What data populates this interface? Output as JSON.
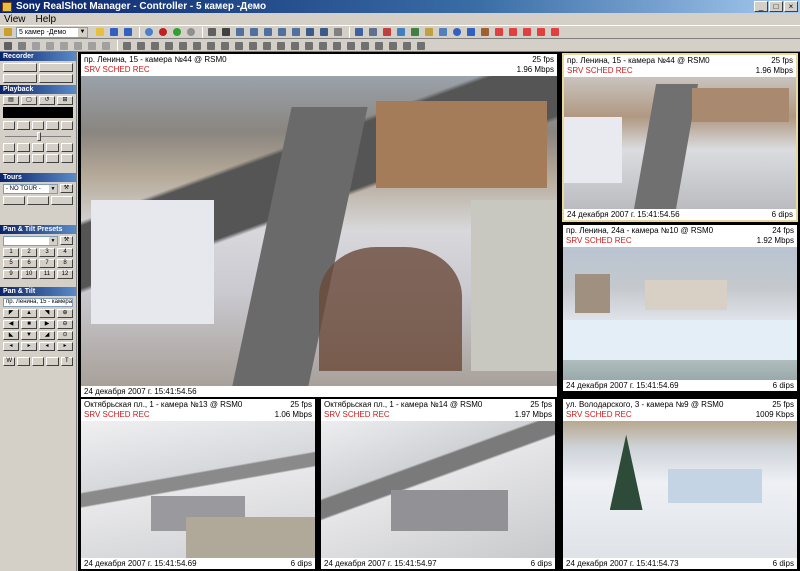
{
  "window": {
    "title": "Sony RealShot Manager - Controller - 5 камер -Демо"
  },
  "menu": [
    "View",
    "Help"
  ],
  "toolbar": {
    "preset_value": "5 камер -Демо"
  },
  "left_panel": {
    "recorder": "Recorder",
    "playback": "Playback",
    "tours": "Tours",
    "tour_value": "- NO TOUR -",
    "presets": "Pan & Tilt Presets",
    "preset_numbers": [
      "1",
      "2",
      "3",
      "4",
      "5",
      "6",
      "7",
      "8",
      "9",
      "10",
      "11",
      "12"
    ],
    "pan_tilt": "Pan & Tilt",
    "current_camera": "пр. Ленина, 15 - камера №4",
    "ptz_row": [
      "W",
      "",
      "",
      "",
      "T"
    ]
  },
  "colors": {
    "rec": "#c81e1e",
    "selected_border": "#e8d89a",
    "title_bar": "#0a246a"
  },
  "tiles": [
    {
      "camera": "пр. Ленина, 15 - камера №44 @ RSM0",
      "fps": "25 fps",
      "rec": "SRV SCHED REC",
      "rate": "1.96 Mbps",
      "timestamp": "24 декабря 2007 г. 15:41:54.56",
      "dips": ""
    },
    {
      "camera": "пр. Ленина, 15 - камера №44 @ RSM0",
      "fps": "25 fps",
      "rec": "SRV SCHED REC",
      "rate": "1.96 Mbps",
      "timestamp": "24 декабря 2007 г. 15:41:54.56",
      "dips": "6 dips"
    },
    {
      "camera": "пр. Ленина, 24а - камера №10 @ RSM0",
      "fps": "24 fps",
      "rec": "SRV SCHED REC",
      "rate": "1.92 Mbps",
      "timestamp": "24 декабря 2007 г. 15:41:54.69",
      "dips": "6 dips"
    },
    {
      "camera": "Октябрьская пл., 1 - камера №13 @ RSM0",
      "fps": "25 fps",
      "rec": "SRV SCHED REC",
      "rate": "1.06 Mbps",
      "timestamp": "24 декабря 2007 г. 15:41:54.69",
      "dips": "6 dips"
    },
    {
      "camera": "Октябрьская пл., 1 - камера №14 @ RSM0",
      "fps": "25 fps",
      "rec": "SRV SCHED REC",
      "rate": "1.97 Mbps",
      "timestamp": "24 декабря 2007 г. 15:41:54.97",
      "dips": "6 dips"
    },
    {
      "camera": "ул. Володарского, 3 - камера №9 @ RSM0",
      "fps": "25 fps",
      "rec": "SRV SCHED REC",
      "rate": "1009 Kbps",
      "timestamp": "24 декабря 2007 г. 15:41:54.73",
      "dips": "6 dips"
    }
  ]
}
